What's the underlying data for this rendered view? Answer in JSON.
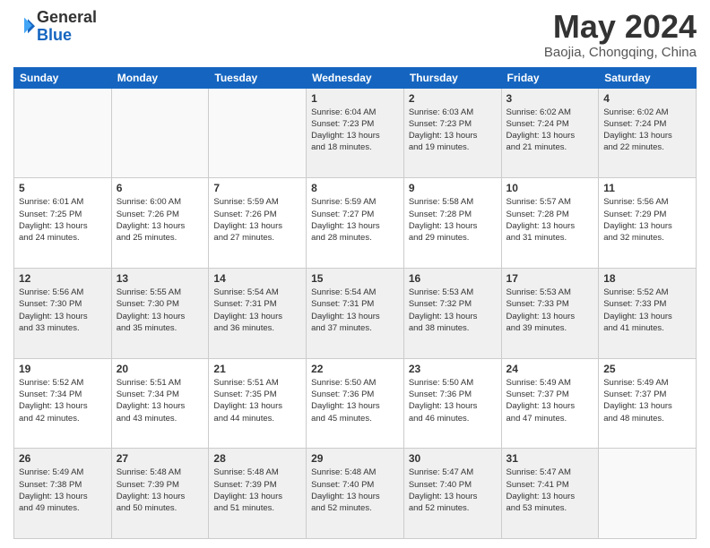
{
  "logo": {
    "general": "General",
    "blue": "Blue"
  },
  "header": {
    "month": "May 2024",
    "location": "Baojia, Chongqing, China"
  },
  "weekdays": [
    "Sunday",
    "Monday",
    "Tuesday",
    "Wednesday",
    "Thursday",
    "Friday",
    "Saturday"
  ],
  "weeks": [
    [
      {
        "day": "",
        "text": ""
      },
      {
        "day": "",
        "text": ""
      },
      {
        "day": "",
        "text": ""
      },
      {
        "day": "1",
        "text": "Sunrise: 6:04 AM\nSunset: 7:23 PM\nDaylight: 13 hours\nand 18 minutes."
      },
      {
        "day": "2",
        "text": "Sunrise: 6:03 AM\nSunset: 7:23 PM\nDaylight: 13 hours\nand 19 minutes."
      },
      {
        "day": "3",
        "text": "Sunrise: 6:02 AM\nSunset: 7:24 PM\nDaylight: 13 hours\nand 21 minutes."
      },
      {
        "day": "4",
        "text": "Sunrise: 6:02 AM\nSunset: 7:24 PM\nDaylight: 13 hours\nand 22 minutes."
      }
    ],
    [
      {
        "day": "5",
        "text": "Sunrise: 6:01 AM\nSunset: 7:25 PM\nDaylight: 13 hours\nand 24 minutes."
      },
      {
        "day": "6",
        "text": "Sunrise: 6:00 AM\nSunset: 7:26 PM\nDaylight: 13 hours\nand 25 minutes."
      },
      {
        "day": "7",
        "text": "Sunrise: 5:59 AM\nSunset: 7:26 PM\nDaylight: 13 hours\nand 27 minutes."
      },
      {
        "day": "8",
        "text": "Sunrise: 5:59 AM\nSunset: 7:27 PM\nDaylight: 13 hours\nand 28 minutes."
      },
      {
        "day": "9",
        "text": "Sunrise: 5:58 AM\nSunset: 7:28 PM\nDaylight: 13 hours\nand 29 minutes."
      },
      {
        "day": "10",
        "text": "Sunrise: 5:57 AM\nSunset: 7:28 PM\nDaylight: 13 hours\nand 31 minutes."
      },
      {
        "day": "11",
        "text": "Sunrise: 5:56 AM\nSunset: 7:29 PM\nDaylight: 13 hours\nand 32 minutes."
      }
    ],
    [
      {
        "day": "12",
        "text": "Sunrise: 5:56 AM\nSunset: 7:30 PM\nDaylight: 13 hours\nand 33 minutes."
      },
      {
        "day": "13",
        "text": "Sunrise: 5:55 AM\nSunset: 7:30 PM\nDaylight: 13 hours\nand 35 minutes."
      },
      {
        "day": "14",
        "text": "Sunrise: 5:54 AM\nSunset: 7:31 PM\nDaylight: 13 hours\nand 36 minutes."
      },
      {
        "day": "15",
        "text": "Sunrise: 5:54 AM\nSunset: 7:31 PM\nDaylight: 13 hours\nand 37 minutes."
      },
      {
        "day": "16",
        "text": "Sunrise: 5:53 AM\nSunset: 7:32 PM\nDaylight: 13 hours\nand 38 minutes."
      },
      {
        "day": "17",
        "text": "Sunrise: 5:53 AM\nSunset: 7:33 PM\nDaylight: 13 hours\nand 39 minutes."
      },
      {
        "day": "18",
        "text": "Sunrise: 5:52 AM\nSunset: 7:33 PM\nDaylight: 13 hours\nand 41 minutes."
      }
    ],
    [
      {
        "day": "19",
        "text": "Sunrise: 5:52 AM\nSunset: 7:34 PM\nDaylight: 13 hours\nand 42 minutes."
      },
      {
        "day": "20",
        "text": "Sunrise: 5:51 AM\nSunset: 7:34 PM\nDaylight: 13 hours\nand 43 minutes."
      },
      {
        "day": "21",
        "text": "Sunrise: 5:51 AM\nSunset: 7:35 PM\nDaylight: 13 hours\nand 44 minutes."
      },
      {
        "day": "22",
        "text": "Sunrise: 5:50 AM\nSunset: 7:36 PM\nDaylight: 13 hours\nand 45 minutes."
      },
      {
        "day": "23",
        "text": "Sunrise: 5:50 AM\nSunset: 7:36 PM\nDaylight: 13 hours\nand 46 minutes."
      },
      {
        "day": "24",
        "text": "Sunrise: 5:49 AM\nSunset: 7:37 PM\nDaylight: 13 hours\nand 47 minutes."
      },
      {
        "day": "25",
        "text": "Sunrise: 5:49 AM\nSunset: 7:37 PM\nDaylight: 13 hours\nand 48 minutes."
      }
    ],
    [
      {
        "day": "26",
        "text": "Sunrise: 5:49 AM\nSunset: 7:38 PM\nDaylight: 13 hours\nand 49 minutes."
      },
      {
        "day": "27",
        "text": "Sunrise: 5:48 AM\nSunset: 7:39 PM\nDaylight: 13 hours\nand 50 minutes."
      },
      {
        "day": "28",
        "text": "Sunrise: 5:48 AM\nSunset: 7:39 PM\nDaylight: 13 hours\nand 51 minutes."
      },
      {
        "day": "29",
        "text": "Sunrise: 5:48 AM\nSunset: 7:40 PM\nDaylight: 13 hours\nand 52 minutes."
      },
      {
        "day": "30",
        "text": "Sunrise: 5:47 AM\nSunset: 7:40 PM\nDaylight: 13 hours\nand 52 minutes."
      },
      {
        "day": "31",
        "text": "Sunrise: 5:47 AM\nSunset: 7:41 PM\nDaylight: 13 hours\nand 53 minutes."
      },
      {
        "day": "",
        "text": ""
      }
    ]
  ]
}
